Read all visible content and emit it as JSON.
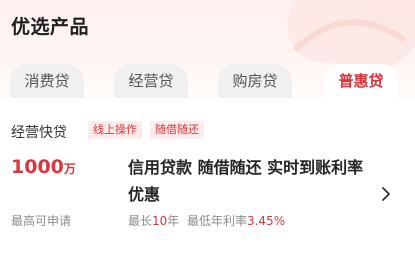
{
  "section": {
    "title": "优选产品"
  },
  "tabs": [
    {
      "label": "消费贷",
      "active": false
    },
    {
      "label": "经营贷",
      "active": false
    },
    {
      "label": "购房贷",
      "active": false
    },
    {
      "label": "普惠贷",
      "active": true
    }
  ],
  "product": {
    "name": "经营快贷",
    "tags": [
      "线上操作",
      "随借随还"
    ],
    "amount_value": "1000",
    "amount_unit": "万",
    "amount_caption": "最高可申请",
    "headline": "信用贷款 随借随还 实时到账利率优惠",
    "term_prefix": "最长",
    "term_value": "10",
    "term_unit": "年",
    "rate_prefix": "最低年利率",
    "rate_value": "3.45%"
  },
  "icons": {
    "chevron": "chevron-right-icon",
    "decoration": "card-decoration"
  },
  "colors": {
    "accent": "#d9363e",
    "tag_background": "#fdeceb",
    "header_gradient_top": "#fdf1ef",
    "inactive_tab": "#f1efef",
    "muted_text": "#8c8c8c"
  }
}
